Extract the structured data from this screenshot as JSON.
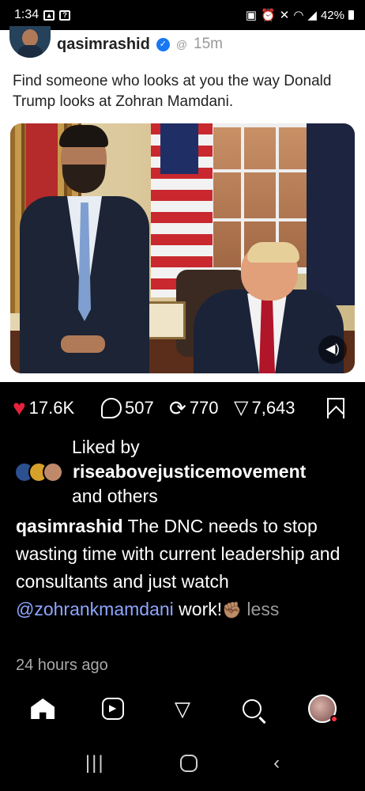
{
  "status_bar": {
    "time": "1:34",
    "battery": "42%",
    "left_icons": [
      "gallery-icon",
      "message-icon"
    ],
    "right_icons": [
      "lock-icon",
      "alarm-icon",
      "mute-icon",
      "wifi-icon",
      "signal-icon",
      "battery-icon"
    ]
  },
  "post": {
    "username": "qasimrashid",
    "time_ago": "15m",
    "text": "Find someone who looks at you the way Donald Trump looks at Zohran Mamdani."
  },
  "actions": {
    "likes": "17.6K",
    "comments": "507",
    "reposts": "770",
    "shares": "7,643"
  },
  "liked_by": {
    "prefix": "Liked by",
    "user": "riseabovejusticemovement",
    "suffix": "and others"
  },
  "caption": {
    "username": "qasimrashid",
    "text": "The DNC needs to stop wasting time with current leadership and consultants and just watch",
    "mention": "@zohrankmamdani",
    "end": "work!",
    "emoji": "✊🏽",
    "less": "less"
  },
  "timestamp": "24 hours ago",
  "colors": {
    "like": "#e8223c",
    "mention": "#8ea6ff",
    "verified": "#1877f2",
    "notification_dot": "#ff3040"
  },
  "nav": [
    "home-icon",
    "reels-icon",
    "share-icon",
    "search-icon",
    "profile-icon"
  ],
  "system_nav": [
    "recents-icon",
    "home-icon",
    "back-icon"
  ]
}
